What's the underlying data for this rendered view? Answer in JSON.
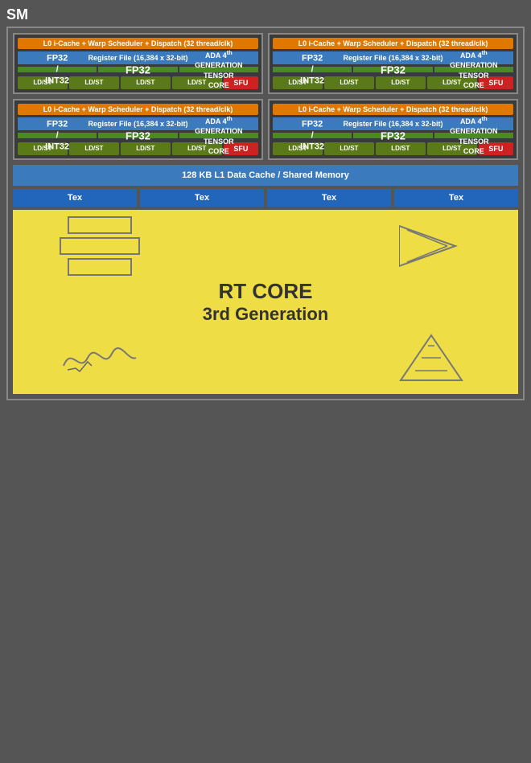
{
  "sm_title": "SM",
  "quads": [
    {
      "l0_label": "L0 i-Cache + Warp Scheduler + Dispatch (32 thread/clk)",
      "register_label": "Register File (16,384 x 32-bit)",
      "fp32_int32_label": "FP32\n/\nINT32",
      "fp32_label": "FP32",
      "tensor_label": "ADA 4th\nGENERATION\nTENSOR CORE",
      "ldst_labels": [
        "LD/ST",
        "LD/ST",
        "LD/ST",
        "LD/ST"
      ],
      "sfu_label": "SFU"
    },
    {
      "l0_label": "L0 i-Cache + Warp Scheduler + Dispatch (32 thread/clk)",
      "register_label": "Register File (16,384 x 32-bit)",
      "fp32_int32_label": "FP32\n/\nINT32",
      "fp32_label": "FP32",
      "tensor_label": "ADA 4th\nGENERATION\nTENSOR CORE",
      "ldst_labels": [
        "LD/ST",
        "LD/ST",
        "LD/ST",
        "LD/ST"
      ],
      "sfu_label": "SFU"
    },
    {
      "l0_label": "L0 i-Cache + Warp Scheduler + Dispatch (32 thread/clk)",
      "register_label": "Register File (16,384 x 32-bit)",
      "fp32_int32_label": "FP32\n/\nINT32",
      "fp32_label": "FP32",
      "tensor_label": "ADA 4th\nGENERATION\nTENSOR CORE",
      "ldst_labels": [
        "LD/ST",
        "LD/ST",
        "LD/ST",
        "LD/ST"
      ],
      "sfu_label": "SFU"
    },
    {
      "l0_label": "L0 i-Cache + Warp Scheduler + Dispatch (32 thread/clk)",
      "register_label": "Register File (16,384 x 32-bit)",
      "fp32_int32_label": "FP32\n/\nINT32",
      "fp32_label": "FP32",
      "tensor_label": "ADA 4th\nGENERATION\nTENSOR CORE",
      "ldst_labels": [
        "LD/ST",
        "LD/ST",
        "LD/ST",
        "LD/ST"
      ],
      "sfu_label": "SFU"
    }
  ],
  "l1_cache_label": "128 KB L1 Data Cache / Shared Memory",
  "tex_labels": [
    "Tex",
    "Tex",
    "Tex",
    "Tex"
  ],
  "rt_core_line1": "RT CORE",
  "rt_core_line2": "3rd Generation"
}
